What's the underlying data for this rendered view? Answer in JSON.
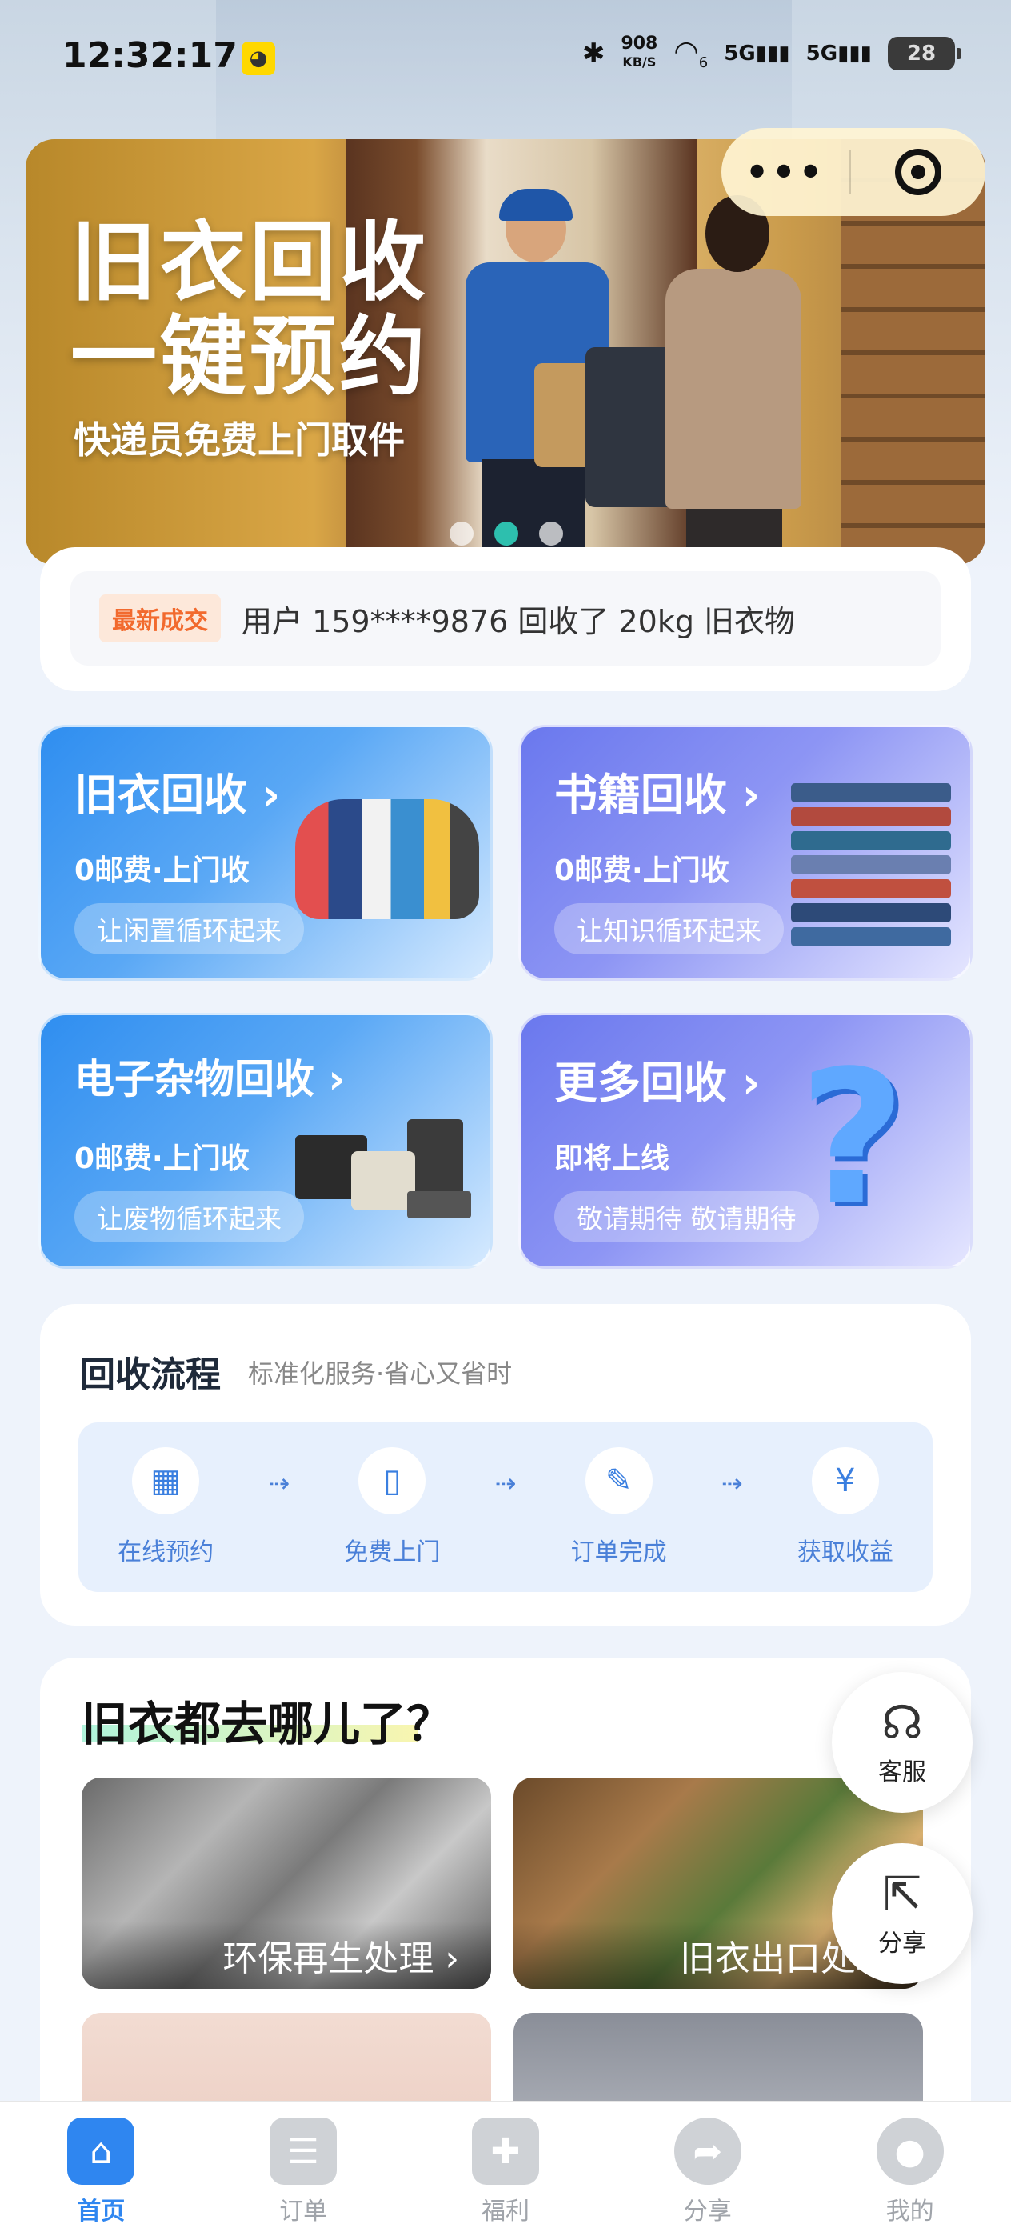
{
  "status_bar": {
    "time": "12:32:17",
    "net_speed": "908",
    "net_speed_unit": "KB/S",
    "signal1": "5G",
    "signal2": "5G",
    "wifi_tag": "6",
    "battery": "28"
  },
  "capsule": {
    "more_label": "•••"
  },
  "banner": {
    "title_line1": "旧衣回收",
    "title_line2": "一键预约",
    "subtitle": "快递员免费上门取件"
  },
  "latest_deal": {
    "tag": "最新成交",
    "text": "用户 159****9876 回收了 20kg 旧衣物"
  },
  "categories": [
    {
      "title": "旧衣回收",
      "sub": "0邮费·上门收",
      "pill": "让闲置循环起来"
    },
    {
      "title": "书籍回收",
      "sub": "0邮费·上门收",
      "pill": "让知识循环起来"
    },
    {
      "title": "电子杂物回收",
      "sub": "0邮费·上门收",
      "pill": "让废物循环起来"
    },
    {
      "title": "更多回收",
      "sub": "即将上线",
      "pill": "敬请期待 敬请期待"
    }
  ],
  "process": {
    "title": "回收流程",
    "subtitle": "标准化服务·省心又省时",
    "steps": [
      {
        "label": "在线预约",
        "icon": "calendar-icon"
      },
      {
        "label": "免费上门",
        "icon": "door-icon"
      },
      {
        "label": "订单完成",
        "icon": "checklist-icon"
      },
      {
        "label": "获取收益",
        "icon": "money-bag-icon"
      }
    ]
  },
  "where": {
    "title": "旧衣都去哪儿了？",
    "photos": [
      {
        "caption": "环保再生处理 ›"
      },
      {
        "caption": "旧衣出口处理"
      }
    ]
  },
  "floating": {
    "service_label": "客服",
    "share_label": "分享"
  },
  "tabbar": [
    {
      "label": "首页",
      "icon": "home-icon",
      "active": true
    },
    {
      "label": "订单",
      "icon": "order-icon",
      "active": false
    },
    {
      "label": "福利",
      "icon": "gift-icon",
      "active": false
    },
    {
      "label": "分享",
      "icon": "share-icon",
      "active": false
    },
    {
      "label": "我的",
      "icon": "profile-icon",
      "active": false
    }
  ],
  "colors": {
    "brand_blue": "#2f86f0",
    "accent_teal": "#2dbfae",
    "deal_orange": "#f26a2e"
  }
}
